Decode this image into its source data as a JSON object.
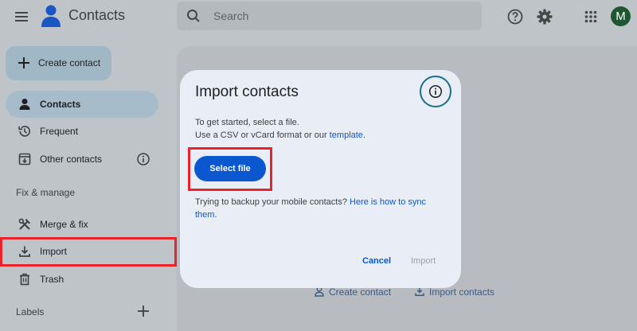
{
  "app": {
    "title": "Contacts"
  },
  "header": {
    "search_placeholder": "Search",
    "avatar_letter": "M",
    "menu_icon": "hamburger-menu-icon",
    "help_icon": "help-circle-icon",
    "settings_icon": "gear-icon",
    "apps_icon": "apps-grid-icon"
  },
  "sidebar": {
    "create_label": "Create contact",
    "items": [
      {
        "label": "Contacts",
        "icon": "person-icon",
        "active": true
      },
      {
        "label": "Frequent",
        "icon": "history-icon",
        "active": false
      },
      {
        "label": "Other contacts",
        "icon": "archive-in-icon",
        "active": false
      }
    ],
    "fix_manage_heading": "Fix & manage",
    "manage_items": [
      {
        "label": "Merge & fix",
        "icon": "hammer-wrench-icon"
      },
      {
        "label": "Import",
        "icon": "download-icon"
      },
      {
        "label": "Trash",
        "icon": "trash-icon"
      }
    ],
    "labels_heading": "Labels"
  },
  "main": {
    "create_contact_link": "Create contact",
    "import_contacts_link": "Import contacts"
  },
  "dialog": {
    "title": "Import contacts",
    "line1": "To get started, select a file.",
    "line2_prefix": "Use a CSV or vCard format or our ",
    "line2_link": "template",
    "line2_suffix": ".",
    "select_file": "Select file",
    "backup_prefix": "Trying to backup your mobile contacts? ",
    "backup_link_part1": "Here is how to sync",
    "backup_link_part2": "them",
    "backup_suffix": ".",
    "cancel": "Cancel",
    "import": "Import"
  },
  "colors": {
    "accent": "#0b57d0",
    "highlight": "#e8232c",
    "avatar": "#1e5631",
    "dialog_bg": "#e9eef6"
  }
}
